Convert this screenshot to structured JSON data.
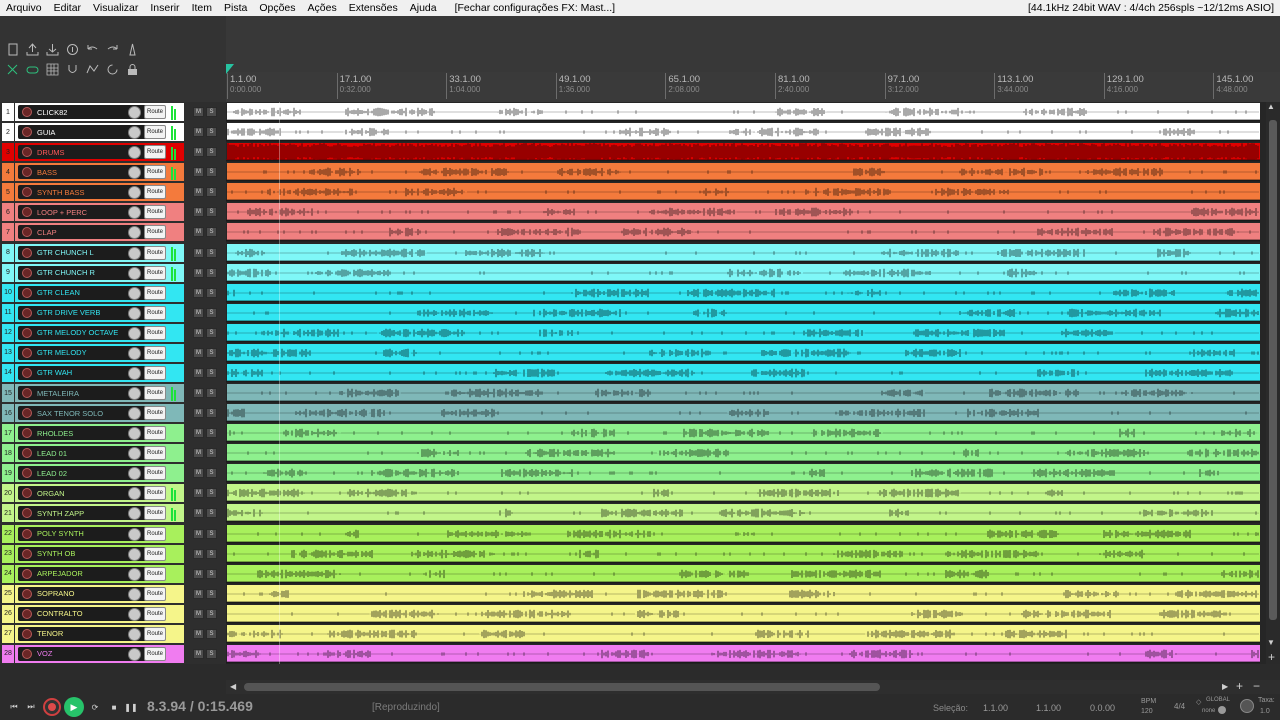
{
  "menu": [
    "Arquivo",
    "Editar",
    "Visualizar",
    "Inserir",
    "Item",
    "Pista",
    "Opções",
    "Ações",
    "Extensões",
    "Ajuda"
  ],
  "window_title": "[Fechar configurações FX: Mast...]",
  "audio_status": "[44.1kHz 24bit WAV : 4/4ch 256spls ~12/12ms ASIO]",
  "toolbar_icons": [
    [
      "new-project-icon",
      "open-project-icon",
      "save-project-icon",
      "project-settings-icon",
      "undo-icon",
      "redo-icon",
      "metronome-icon"
    ],
    [
      "ripple-edit-icon",
      "loop-icon",
      "grid-icon",
      "snap-icon",
      "envelope-icon",
      "lock-toggle-icon",
      "lock-icon"
    ]
  ],
  "ruler": [
    {
      "bar": "1.1.00",
      "time": "0:00.000"
    },
    {
      "bar": "17.1.00",
      "time": "0:32.000"
    },
    {
      "bar": "33.1.00",
      "time": "1:04.000"
    },
    {
      "bar": "49.1.00",
      "time": "1:36.000"
    },
    {
      "bar": "65.1.00",
      "time": "2:08.000"
    },
    {
      "bar": "81.1.00",
      "time": "2:40.000"
    },
    {
      "bar": "97.1.00",
      "time": "3:12.000"
    },
    {
      "bar": "113.1.00",
      "time": "3:44.000"
    },
    {
      "bar": "129.1.00",
      "time": "4:16.000"
    },
    {
      "bar": "145.1.00",
      "time": "4:48.000"
    }
  ],
  "route_label": "Route",
  "mute_label": "M",
  "solo_label": "S",
  "tracks": [
    {
      "num": "1",
      "name": "CLICK82",
      "color": "#ffffff",
      "text": "#ffffff",
      "meter": true
    },
    {
      "num": "2",
      "name": "GUIA",
      "color": "#ffffff",
      "text": "#ffffff",
      "meter": true
    },
    {
      "num": "3",
      "name": "DRUMS",
      "color": "#e00000",
      "text": "#ff5a5a",
      "meter": true
    },
    {
      "num": "4",
      "name": "BASS",
      "color": "#f47a3c",
      "text": "#f47a3c",
      "meter": true
    },
    {
      "num": "5",
      "name": "SYNTH BASS",
      "color": "#f47a3c",
      "text": "#f47a3c",
      "meter": false
    },
    {
      "num": "6",
      "name": "LOOP + PERC",
      "color": "#f08080",
      "text": "#f08080",
      "meter": false
    },
    {
      "num": "7",
      "name": "CLAP",
      "color": "#f08080",
      "text": "#f08080",
      "meter": false
    },
    {
      "num": "8",
      "name": "GTR CHUNCH L",
      "color": "#7ff7f7",
      "text": "#7ff7f7",
      "meter": true
    },
    {
      "num": "9",
      "name": "GTR CHUNCH R",
      "color": "#7ff7f7",
      "text": "#7ff7f7",
      "meter": true
    },
    {
      "num": "10",
      "name": "GTR CLEAN",
      "color": "#32e6f2",
      "text": "#32e6f2",
      "meter": false
    },
    {
      "num": "11",
      "name": "GTR DRIVE VERB",
      "color": "#32e6f2",
      "text": "#32e6f2",
      "meter": false
    },
    {
      "num": "12",
      "name": "GTR MELODY OCTAVE",
      "color": "#32e6f2",
      "text": "#32e6f2",
      "meter": false
    },
    {
      "num": "13",
      "name": "GTR MELODY",
      "color": "#32e6f2",
      "text": "#32e6f2",
      "meter": false
    },
    {
      "num": "14",
      "name": "GTR WAH",
      "color": "#32e6f2",
      "text": "#32e6f2",
      "meter": false
    },
    {
      "num": "15",
      "name": "METALEIRA",
      "color": "#7fb8b8",
      "text": "#7fb8b8",
      "meter": true
    },
    {
      "num": "16",
      "name": "SAX TENOR SOLO",
      "color": "#7fb8b8",
      "text": "#7fb8b8",
      "meter": false
    },
    {
      "num": "17",
      "name": "RHOLDES",
      "color": "#8ef08e",
      "text": "#8ef08e",
      "meter": false
    },
    {
      "num": "18",
      "name": "LEAD 01",
      "color": "#8ef08e",
      "text": "#8ef08e",
      "meter": false
    },
    {
      "num": "19",
      "name": "LEAD 02",
      "color": "#8ef08e",
      "text": "#8ef08e",
      "meter": false
    },
    {
      "num": "20",
      "name": "ORGAN",
      "color": "#c2f58a",
      "text": "#c2f58a",
      "meter": true
    },
    {
      "num": "21",
      "name": "SYNTH ZAPP",
      "color": "#c2f58a",
      "text": "#c2f58a",
      "meter": true
    },
    {
      "num": "22",
      "name": "POLY SYNTH",
      "color": "#a8f05c",
      "text": "#a8f05c",
      "meter": false
    },
    {
      "num": "23",
      "name": "SYNTH OB",
      "color": "#a8f05c",
      "text": "#a8f05c",
      "meter": false
    },
    {
      "num": "24",
      "name": "ARPEJADOR",
      "color": "#a8f05c",
      "text": "#a8f05c",
      "meter": false
    },
    {
      "num": "25",
      "name": "SOPRANO",
      "color": "#f5f58a",
      "text": "#f5f58a",
      "meter": false
    },
    {
      "num": "26",
      "name": "CONTRALTO",
      "color": "#f5f58a",
      "text": "#f5f58a",
      "meter": false
    },
    {
      "num": "27",
      "name": "TENOR",
      "color": "#f5f58a",
      "text": "#f5f58a",
      "meter": false
    },
    {
      "num": "28",
      "name": "VOZ",
      "color": "#f07cf0",
      "text": "#f07cf0",
      "meter": false
    }
  ],
  "transport": {
    "time": "8.3.94 / 0:15.469",
    "state": "[Reproduzindo]",
    "selection_label": "Seleção:",
    "sel_start": "1.1.00",
    "sel_end": "1.1.00",
    "sel_length": "0.0.00",
    "bpm_label": "BPM",
    "bpm": "120",
    "time_signature": "4/4",
    "global_label": "GLOBAL",
    "global_sub": "none",
    "rate_label": "Taxa:",
    "rate": "1.0"
  }
}
